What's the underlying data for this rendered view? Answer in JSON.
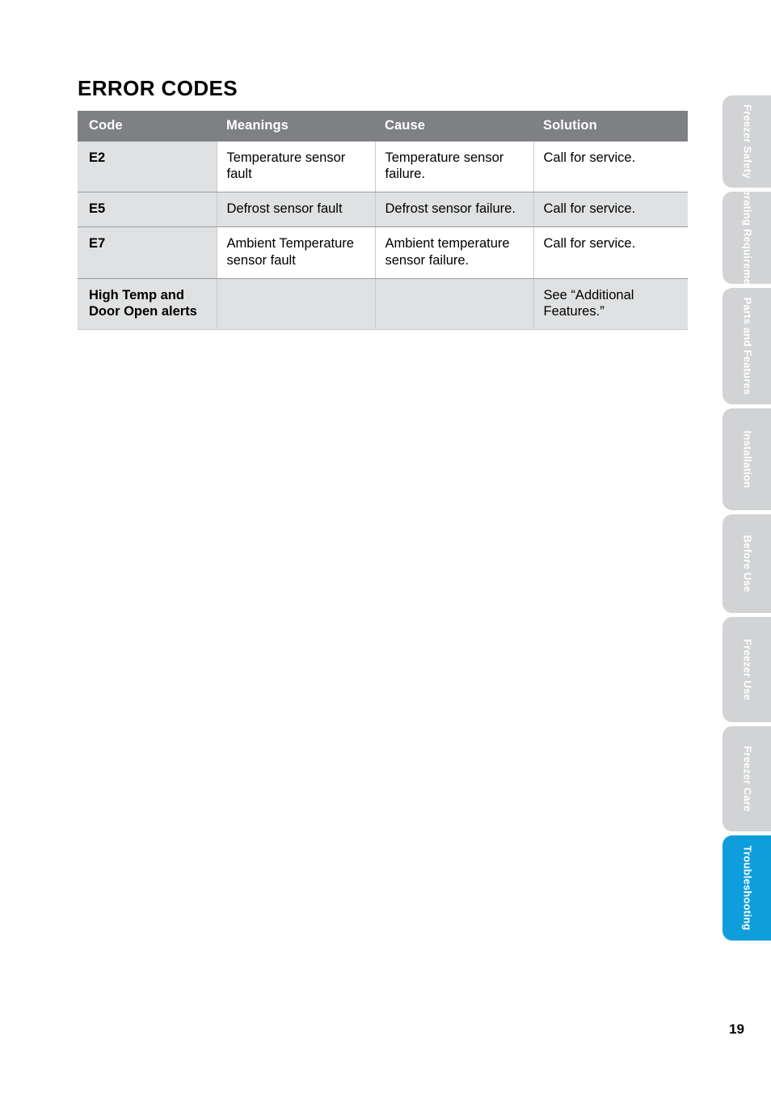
{
  "page": {
    "title": "ERROR CODES",
    "number": "19"
  },
  "table": {
    "headers": [
      "Code",
      "Meanings",
      "Cause",
      "Solution"
    ],
    "rows": [
      {
        "code": "E2",
        "meanings": "Temperature sensor fault",
        "cause": "Temperature sensor failure.",
        "solution": "Call for service.",
        "stripe": "white"
      },
      {
        "code": "E5",
        "meanings": "Defrost sensor fault",
        "cause": "Defrost sensor failure.",
        "solution": "Call for service.",
        "stripe": "gray"
      },
      {
        "code": "E7",
        "meanings": "Ambient Temperature sensor fault",
        "cause": "Ambient temperature sensor failure.",
        "solution": "Call for service.",
        "stripe": "white"
      },
      {
        "code": "High Temp and Door Open alerts",
        "meanings": "",
        "cause": "",
        "solution": "See “Additional Features.”",
        "stripe": "gray"
      }
    ]
  },
  "side_tabs": [
    {
      "label": "Freezer Safety",
      "active": false
    },
    {
      "label": "Operating Requirements",
      "active": false
    },
    {
      "label": "Parts and Features",
      "active": false
    },
    {
      "label": "Installation",
      "active": false
    },
    {
      "label": "Before Use",
      "active": false
    },
    {
      "label": "Freezer Use",
      "active": false
    },
    {
      "label": "Freezer Care",
      "active": false
    },
    {
      "label": "Troubleshooting",
      "active": true
    }
  ],
  "colors": {
    "header_gray": "#7e8083",
    "row_gray": "#e0e1e2",
    "tab_gray": "#d2d3d5",
    "tab_active_blue": "#0d9edb"
  }
}
